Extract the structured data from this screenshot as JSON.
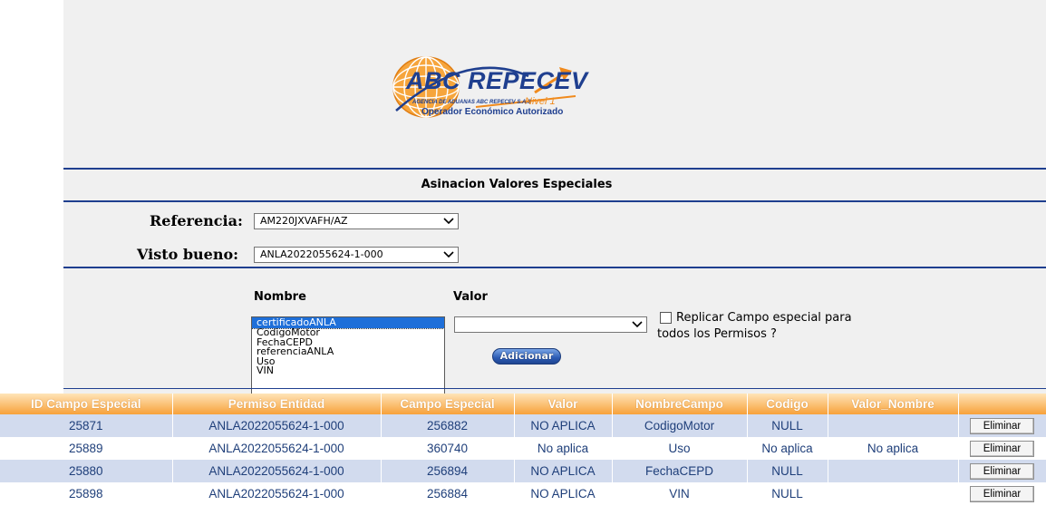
{
  "logo": {
    "title": "ABC REPECEV",
    "subtitle": "AGENCIA DE ADUANAS ABC REPECEV S.A.S",
    "level": "Nivel 1",
    "tagline": "Operador Económico Autorizado"
  },
  "form": {
    "title": "Asinacion Valores Especiales",
    "referencia": {
      "label": "Referencia:",
      "value": "AM220JXVAFH/AZ"
    },
    "visto_bueno": {
      "label": "Visto bueno:",
      "value": "ANLA2022055624-1-000"
    },
    "nombre_label": "Nombre",
    "valor_label": "Valor",
    "valor_value": "",
    "nombre_options": [
      "certificadoANLA",
      "CodigoMotor",
      "FechaCEPD",
      "referenciaANLA",
      "Uso",
      "VIN"
    ],
    "nombre_selected": "certificadoANLA",
    "replicar_line1": "Replicar Campo especial para",
    "replicar_line2": "todos los Permisos ?",
    "replicar_checked": false,
    "add_button": "Adicionar"
  },
  "table": {
    "headers": [
      "ID Campo Especial",
      "Permiso Entidad",
      "Campo Especial",
      "Valor",
      "NombreCampo",
      "Codigo",
      "Valor_Nombre",
      ""
    ],
    "rows": [
      [
        "25871",
        "ANLA2022055624-1-000",
        "256882",
        "NO APLICA",
        "CodigoMotor",
        "NULL",
        "",
        "Eliminar"
      ],
      [
        "25889",
        "ANLA2022055624-1-000",
        "360740",
        "No aplica",
        "Uso",
        "No aplica",
        "No aplica",
        "Eliminar"
      ],
      [
        "25880",
        "ANLA2022055624-1-000",
        "256894",
        "NO APLICA",
        "FechaCEPD",
        "NULL",
        "",
        "Eliminar"
      ],
      [
        "25898",
        "ANLA2022055624-1-000",
        "256884",
        "NO APLICA",
        "VIN",
        "NULL",
        "",
        "Eliminar"
      ]
    ]
  },
  "colors": {
    "header_orange": "#f7a13a",
    "row_blue": "#d2dbee",
    "brand_blue": "#1f3f8f",
    "brand_orange": "#f08a1c"
  }
}
